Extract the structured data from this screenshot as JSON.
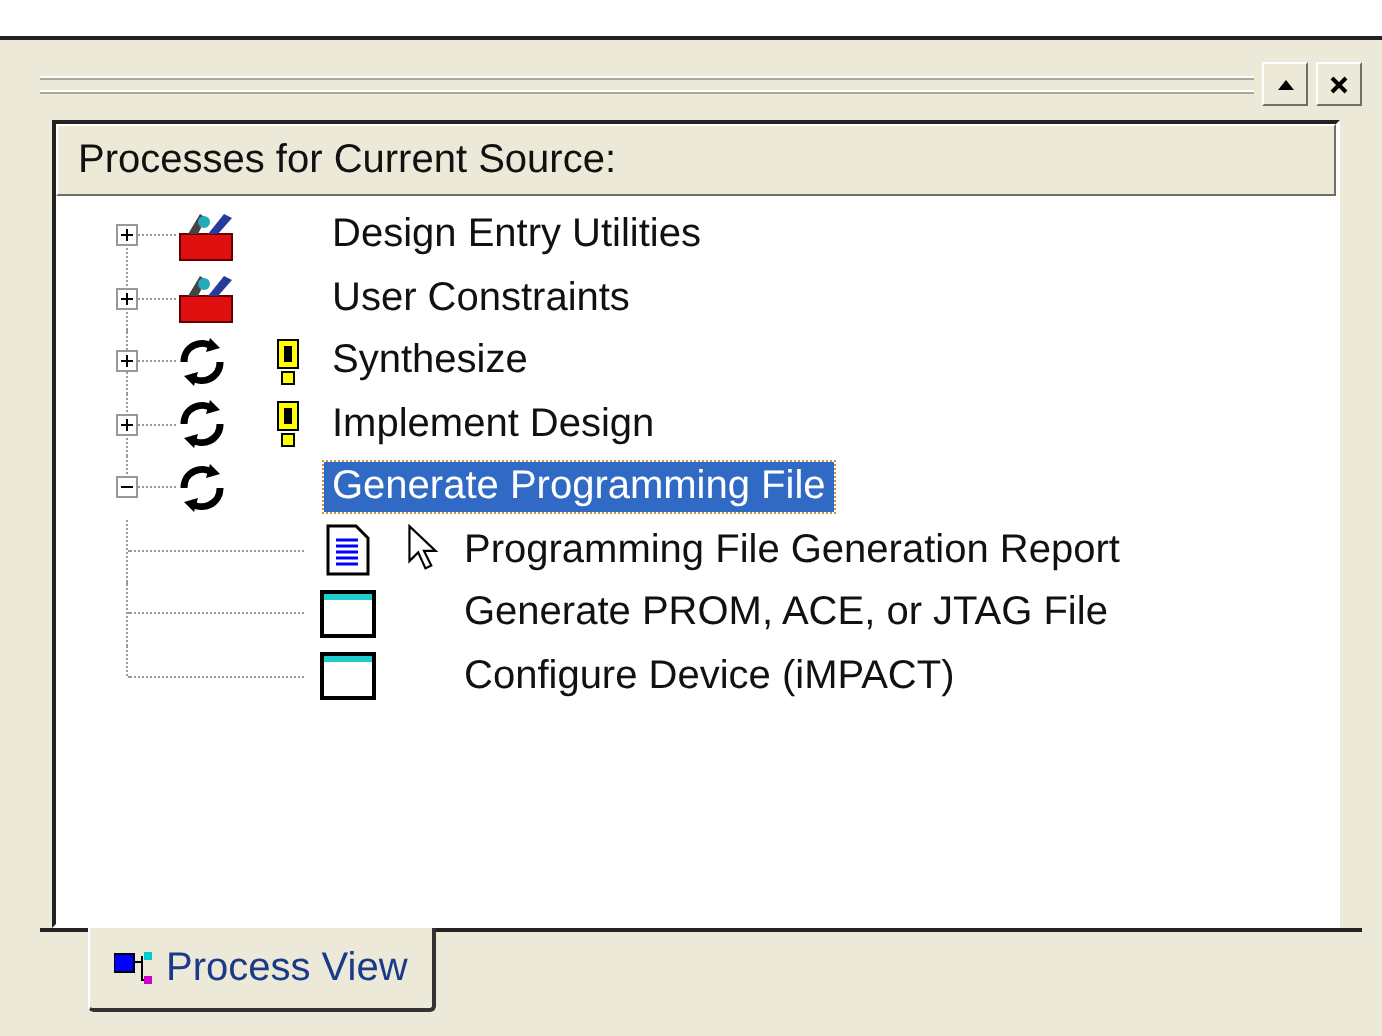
{
  "header": {
    "title": "Processes for Current Source:"
  },
  "tree": [
    {
      "label": "Design Entry Utilities",
      "kind": "toolbox",
      "warning": false,
      "expanded": false,
      "selected": false
    },
    {
      "label": "User Constraints",
      "kind": "toolbox",
      "warning": false,
      "expanded": false,
      "selected": false
    },
    {
      "label": "Synthesize",
      "kind": "process",
      "warning": true,
      "expanded": false,
      "selected": false
    },
    {
      "label": "Implement Design",
      "kind": "process",
      "warning": true,
      "expanded": false,
      "selected": false
    },
    {
      "label": "Generate Programming File",
      "kind": "process",
      "warning": false,
      "expanded": true,
      "selected": true,
      "children": [
        {
          "label": "Programming File Generation Report",
          "kind": "report",
          "warning": false,
          "selected": false
        },
        {
          "label": "Generate PROM, ACE, or JTAG File",
          "kind": "window",
          "warning": false,
          "selected": false
        },
        {
          "label": "Configure Device (iMPACT)",
          "kind": "window",
          "warning": false,
          "selected": false
        }
      ]
    }
  ],
  "tabs": [
    {
      "label": "Process View",
      "selected": true
    }
  ]
}
